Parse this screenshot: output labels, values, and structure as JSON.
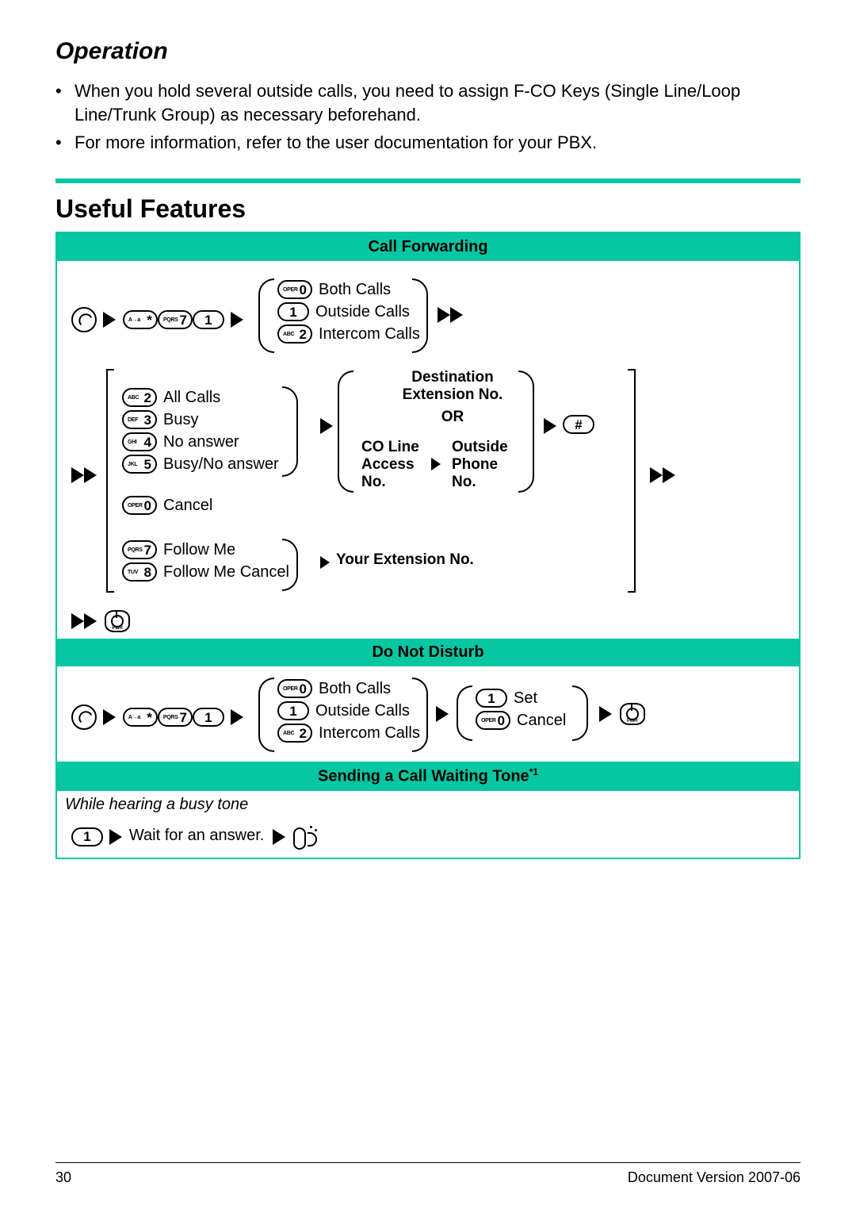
{
  "header": {
    "title": "Operation"
  },
  "bullets": [
    "When you hold several outside calls, you need to assign F-CO Keys (Single Line/Loop Line/Trunk Group) as necessary beforehand.",
    "For more information, refer to the user documentation for your PBX."
  ],
  "section_title": "Useful Features",
  "banners": {
    "cf": "Call Forwarding",
    "dnd": "Do Not Disturb",
    "cw": "Sending a Call Waiting Tone"
  },
  "cw_sup": "*1",
  "keys": {
    "star": {
      "sub": "A→a",
      "main": "*"
    },
    "k7": {
      "sub": "PQRS",
      "main": "7"
    },
    "k1": {
      "sub": "",
      "main": "1"
    },
    "k1o": {
      "main": "1"
    },
    "k0": {
      "sub": "OPER",
      "main": "0"
    },
    "k2": {
      "sub": "ABC",
      "main": "2"
    },
    "k3": {
      "sub": "DEF",
      "main": "3"
    },
    "k4": {
      "sub": "GHI",
      "main": "4"
    },
    "k5": {
      "sub": "JKL",
      "main": "5"
    },
    "k8": {
      "sub": "TUV",
      "main": "8"
    },
    "hash": {
      "main": "#"
    },
    "pwr": {
      "sub": "PWR"
    }
  },
  "cf": {
    "group1": {
      "opt0": "Both Calls",
      "opt1": "Outside Calls",
      "opt2": "Intercom Calls"
    },
    "group2": {
      "opt2": "All Calls",
      "opt3": "Busy",
      "opt4": "No answer",
      "opt5": "Busy/No answer",
      "opt0": "Cancel",
      "opt7": "Follow Me",
      "opt8": "Follow Me Cancel"
    },
    "dest": {
      "title1": "Destination",
      "title2": "Extension No.",
      "or": "OR",
      "co1": "CO Line",
      "co2": "Access",
      "co3": "No.",
      "out1": "Outside",
      "out2": "Phone",
      "out3": "No."
    },
    "your_ext": "Your Extension No."
  },
  "dnd": {
    "group1": {
      "opt0": "Both Calls",
      "opt1": "Outside Calls",
      "opt2": "Intercom Calls"
    },
    "group2": {
      "opt1": "Set",
      "opt0": "Cancel"
    }
  },
  "cw": {
    "intro": "While hearing a busy tone",
    "wait": "Wait for an answer."
  },
  "footer": {
    "page": "30",
    "version": "Document Version 2007-06"
  }
}
